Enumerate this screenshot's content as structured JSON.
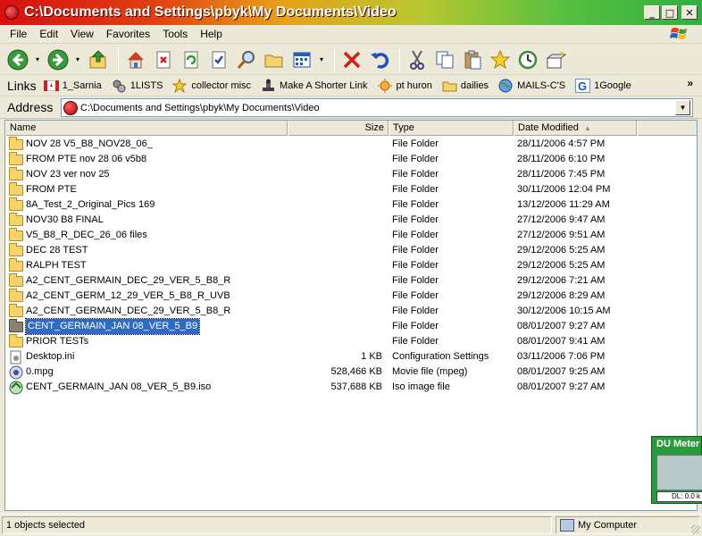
{
  "window": {
    "title": "C:\\Documents and Settings\\pbyk\\My Documents\\Video",
    "min_symbol": "_",
    "max_symbol": "□",
    "close_symbol": "✕"
  },
  "menu": {
    "items": [
      {
        "label": "File"
      },
      {
        "label": "Edit"
      },
      {
        "label": "View"
      },
      {
        "label": "Favorites"
      },
      {
        "label": "Tools"
      },
      {
        "label": "Help"
      }
    ]
  },
  "links": {
    "label": "Links",
    "more": "»",
    "items": [
      {
        "label": "1_Sarnia",
        "icon": "canada-flag-icon"
      },
      {
        "label": "1LISTS",
        "icon": "gears-icon"
      },
      {
        "label": "collector misc",
        "icon": "star-icon"
      },
      {
        "label": "Make A Shorter Link",
        "icon": "stamp-icon"
      },
      {
        "label": "pt huron",
        "icon": "sun-icon"
      },
      {
        "label": "dailies",
        "icon": "folder-icon"
      },
      {
        "label": "MAILS-C'S",
        "icon": "globe-icon"
      },
      {
        "label": "1Google",
        "icon": "google-icon"
      }
    ]
  },
  "address": {
    "label": "Address",
    "value": "C:\\Documents and Settings\\pbyk\\My Documents\\Video"
  },
  "columns": {
    "name": "Name",
    "size": "Size",
    "type": "Type",
    "date": "Date Modified"
  },
  "files": [
    {
      "name": "NOV 28 V5_B8_NOV28_06_",
      "size": "",
      "type": "File Folder",
      "date": "28/11/2006 4:57 PM",
      "icon": "folder-icon"
    },
    {
      "name": "FROM PTE nov 28 06 v5b8",
      "size": "",
      "type": "File Folder",
      "date": "28/11/2006 6:10 PM",
      "icon": "folder-icon"
    },
    {
      "name": "NOV 23 ver nov 25",
      "size": "",
      "type": "File Folder",
      "date": "28/11/2006 7:45 PM",
      "icon": "folder-icon"
    },
    {
      "name": "FROM PTE",
      "size": "",
      "type": "File Folder",
      "date": "30/11/2006 12:04 PM",
      "icon": "folder-icon"
    },
    {
      "name": " 8A_Test_2_Original_Pics 169",
      "size": "",
      "type": "File Folder",
      "date": "13/12/2006 11:29 AM",
      "icon": "folder-icon"
    },
    {
      "name": "NOV30 B8 FINAL",
      "size": "",
      "type": "File Folder",
      "date": "27/12/2006 9:47 AM",
      "icon": "folder-icon"
    },
    {
      "name": "V5_B8_R_DEC_26_06 files",
      "size": "",
      "type": "File Folder",
      "date": "27/12/2006 9:51 AM",
      "icon": "folder-icon"
    },
    {
      "name": "DEC 28 TEST",
      "size": "",
      "type": "File Folder",
      "date": "29/12/2006 5:25 AM",
      "icon": "folder-icon"
    },
    {
      "name": "RALPH TEST",
      "size": "",
      "type": "File Folder",
      "date": "29/12/2006 5:25 AM",
      "icon": "folder-icon"
    },
    {
      "name": " A2_CENT_GERMAIN_DEC_29_VER_5_B8_R",
      "size": "",
      "type": "File Folder",
      "date": "29/12/2006 7:21 AM",
      "icon": "folder-icon"
    },
    {
      "name": "A2_CENT_GERM_12_29_VER_5_B8_R_UVB",
      "size": "",
      "type": "File Folder",
      "date": "29/12/2006 8:29 AM",
      "icon": "folder-icon"
    },
    {
      "name": "A2_CENT_GERMAIN_DEC_29_VER_5_B8_R",
      "size": "",
      "type": "File Folder",
      "date": "30/12/2006 10:15 AM",
      "icon": "folder-icon"
    },
    {
      "name": " CENT_GERMAIN_JAN 08_VER_5_B9",
      "size": "",
      "type": "File Folder",
      "date": "08/01/2007 9:27 AM",
      "icon": "folder-icon",
      "selected": true
    },
    {
      "name": "PRIOR TESTs",
      "size": "",
      "type": "File Folder",
      "date": "08/01/2007 9:41 AM",
      "icon": "folder-icon"
    },
    {
      "name": "Desktop.ini",
      "size": "1 KB",
      "type": "Configuration Settings",
      "date": "03/11/2006 7:06 PM",
      "icon": "settings-file-icon"
    },
    {
      "name": "0.mpg",
      "size": "528,466 KB",
      "type": "Movie file (mpeg)",
      "date": "08/01/2007 9:25 AM",
      "icon": "movie-file-icon"
    },
    {
      "name": " CENT_GERMAIN_JAN 08_VER_5_B9.iso",
      "size": "537,688 KB",
      "type": "Iso image file",
      "date": "08/01/2007 9:27 AM",
      "icon": "disc-image-icon"
    }
  ],
  "du_meter": {
    "title": "DU Meter",
    "readout": "DL: 0.0 k"
  },
  "status": {
    "left": "1 objects selected",
    "right": "My Computer"
  }
}
